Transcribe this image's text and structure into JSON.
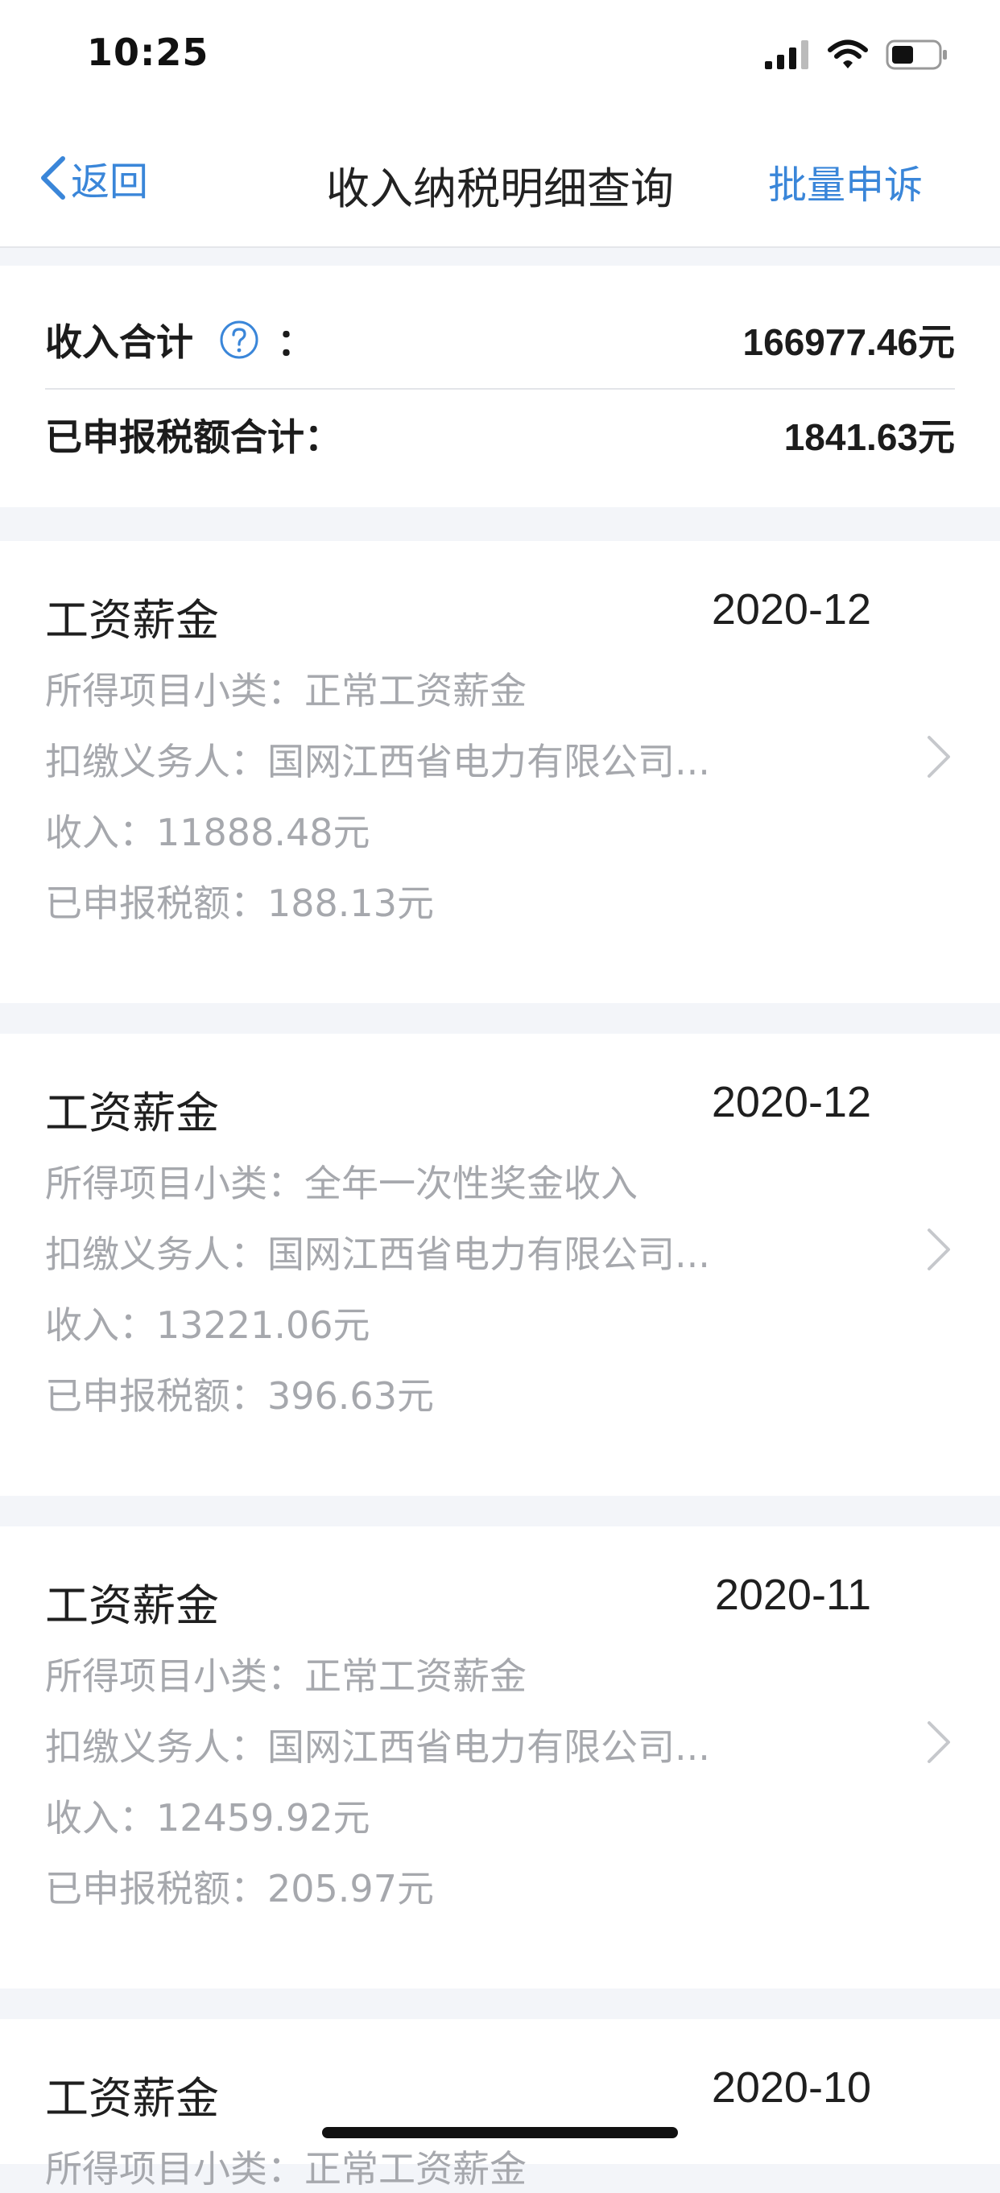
{
  "status_bar": {
    "time": "10:25"
  },
  "nav": {
    "back_label": "返回",
    "title": "收入纳税明细查询",
    "action_label": "批量申诉"
  },
  "summary": {
    "income_label": "收入合计",
    "income_colon": "：",
    "income_value": "166977.46元",
    "tax_label": "已申报税额合计：",
    "tax_value": "1841.63元"
  },
  "records": [
    {
      "title": "工资薪金",
      "date": "2020-12",
      "subcategory_label": "所得项目小类：",
      "subcategory": "正常工资薪金",
      "payer_label": "扣缴义务人：",
      "payer": "国网江西省电力有限公司...",
      "income_label": "收入：",
      "income": "11888.48元",
      "tax_label": "已申报税额：",
      "tax": "188.13元"
    },
    {
      "title": "工资薪金",
      "date": "2020-12",
      "subcategory_label": "所得项目小类：",
      "subcategory": "全年一次性奖金收入",
      "payer_label": "扣缴义务人：",
      "payer": "国网江西省电力有限公司...",
      "income_label": "收入：",
      "income": "13221.06元",
      "tax_label": "已申报税额：",
      "tax": "396.63元"
    },
    {
      "title": "工资薪金",
      "date": "2020-11",
      "subcategory_label": "所得项目小类：",
      "subcategory": "正常工资薪金",
      "payer_label": "扣缴义务人：",
      "payer": "国网江西省电力有限公司...",
      "income_label": "收入：",
      "income": "12459.92元",
      "tax_label": "已申报税额：",
      "tax": "205.97元"
    },
    {
      "title": "工资薪金",
      "date": "2020-10",
      "subcategory_label": "所得项目小类：",
      "subcategory": "正常工资薪金"
    }
  ],
  "colors": {
    "accent": "#3a86d9",
    "page_bg": "#f3f5f9",
    "secondary_text": "#a6a8ad"
  },
  "icons": {
    "back": "chevron-left-icon",
    "help": "question-circle-icon",
    "row": "chevron-right-icon"
  }
}
